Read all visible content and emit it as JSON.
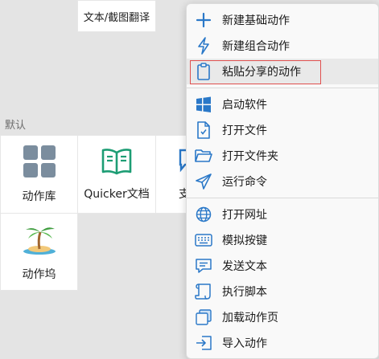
{
  "background": {
    "top_tile_label": "文本/截图翻译",
    "section_label": "默认",
    "tiles": [
      {
        "label": "动作库",
        "icon": "grid-icon"
      },
      {
        "label": "Quicker文档",
        "icon": "open-book-icon"
      },
      {
        "label": "支",
        "icon": "chat-icon"
      },
      {
        "label": "动作坞",
        "icon": "palm-island-icon"
      }
    ]
  },
  "menu": {
    "items": [
      {
        "label": "新建基础动作",
        "icon": "plus-icon"
      },
      {
        "label": "新建组合动作",
        "icon": "lightning-icon"
      },
      {
        "label": "粘贴分享的动作",
        "icon": "clipboard-icon",
        "highlighted": true
      },
      {
        "label": "启动软件",
        "icon": "windows-icon"
      },
      {
        "label": "打开文件",
        "icon": "file-icon"
      },
      {
        "label": "打开文件夹",
        "icon": "folder-icon"
      },
      {
        "label": "运行命令",
        "icon": "send-icon"
      },
      {
        "label": "打开网址",
        "icon": "globe-icon"
      },
      {
        "label": "模拟按键",
        "icon": "keyboard-icon"
      },
      {
        "label": "发送文本",
        "icon": "message-icon"
      },
      {
        "label": "执行脚本",
        "icon": "script-icon"
      },
      {
        "label": "加载动作页",
        "icon": "pages-icon"
      },
      {
        "label": "导入动作",
        "icon": "import-icon"
      }
    ]
  },
  "colors": {
    "accent_blue": "#2a78c8",
    "highlight_border": "#e0504f",
    "tile_gray": "#7b8d9e",
    "book_green": "#1d9d74"
  }
}
